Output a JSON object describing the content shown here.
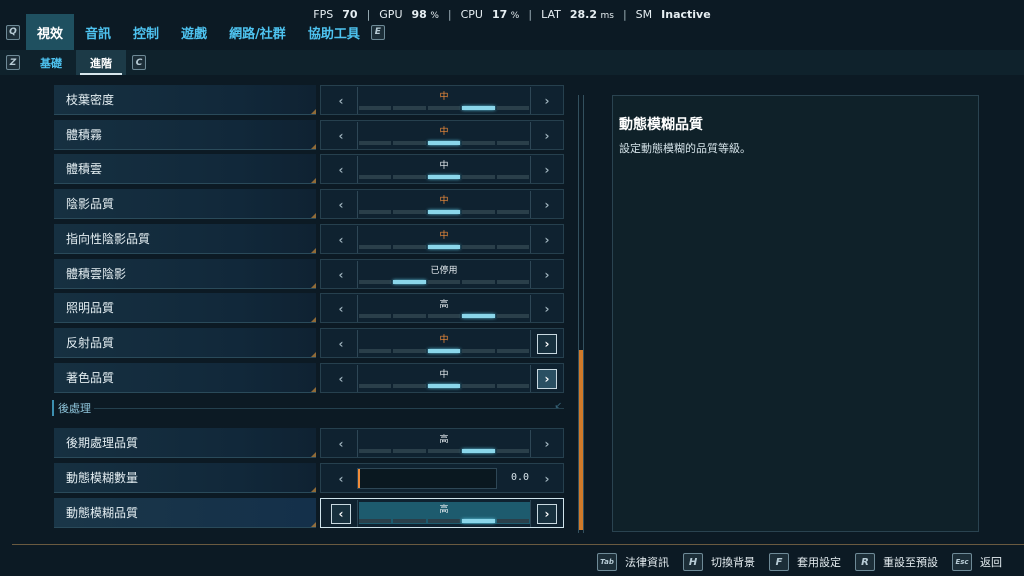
{
  "perf": {
    "fps_label": "FPS",
    "fps": "70",
    "gpu_label": "GPU",
    "gpu": "98",
    "gpu_unit": "%",
    "cpu_label": "CPU",
    "cpu": "17",
    "cpu_unit": "%",
    "lat_label": "LAT",
    "lat": "28.2",
    "lat_unit": "ms",
    "sm_label": "SM",
    "sm": "Inactive",
    "separator": "|"
  },
  "main_tabs": {
    "prev_key": "Q",
    "next_key": "E",
    "items": [
      "視效",
      "音訊",
      "控制",
      "遊戲",
      "網路/社群",
      "協助工具"
    ],
    "active_index": 0
  },
  "sub_tabs": {
    "prev_key": "Z",
    "next_key": "C",
    "items": [
      "基礎",
      "進階"
    ],
    "active_index": 1
  },
  "settings": [
    {
      "label": "枝葉密度",
      "value": "中",
      "orange": true,
      "level": 3
    },
    {
      "label": "體積霧",
      "value": "中",
      "orange": true,
      "level": 2
    },
    {
      "label": "體積雲",
      "value": "中",
      "orange": false,
      "level": 2
    },
    {
      "label": "陰影品質",
      "value": "中",
      "orange": true,
      "level": 2
    },
    {
      "label": "指向性陰影品質",
      "value": "中",
      "orange": true,
      "level": 2
    },
    {
      "label": "體積雲陰影",
      "value": "已停用",
      "orange": false,
      "level": 1
    },
    {
      "label": "照明品質",
      "value": "高",
      "orange": false,
      "level": 3
    },
    {
      "label": "反射品質",
      "value": "中",
      "orange": true,
      "level": 2
    },
    {
      "label": "著色品質",
      "value": "中",
      "orange": false,
      "level": 2
    }
  ],
  "post_section": {
    "title": "後處理",
    "items": [
      {
        "label": "後期處理品質",
        "value": "高",
        "orange": false,
        "level": 3
      },
      {
        "label": "動態模糊數量",
        "number": "0.0"
      },
      {
        "label": "動態模糊品質",
        "value": "高",
        "orange": false,
        "level": 3,
        "selected": true
      }
    ]
  },
  "description": {
    "title": "動態模糊品質",
    "text": "設定動態模糊的品質等級。"
  },
  "bottom_hints": [
    {
      "key": "Tab",
      "label": "法律資訊"
    },
    {
      "key": "H",
      "label": "切換背景"
    },
    {
      "key": "F",
      "label": "套用設定"
    },
    {
      "key": "R",
      "label": "重設至預設"
    },
    {
      "key": "Esc",
      "label": "返回"
    }
  ]
}
